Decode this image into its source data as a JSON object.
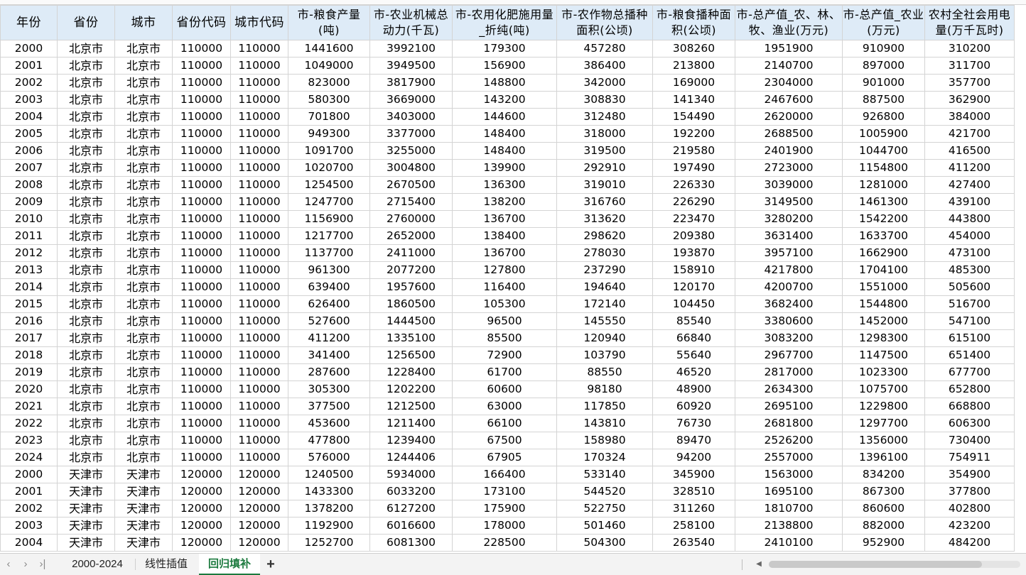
{
  "headers": [
    "年份",
    "省份",
    "城市",
    "省份代码",
    "城市代码",
    "市-粮食产量(吨)",
    "市-农业机械总动力(千瓦)",
    "市-农用化肥施用量_折纯(吨)",
    "市-农作物总播种面积(公顷)",
    "市-粮食播种面积(公顷)",
    "市-总产值_农、林、牧、渔业(万元)",
    "市-总产值_农业(万元)",
    "农村全社会用电量(万千瓦时)"
  ],
  "rows": [
    [
      "2000",
      "北京市",
      "北京市",
      "110000",
      "110000",
      "1441600",
      "3992100",
      "179300",
      "457280",
      "308260",
      "1951900",
      "910900",
      "310200"
    ],
    [
      "2001",
      "北京市",
      "北京市",
      "110000",
      "110000",
      "1049000",
      "3949500",
      "156900",
      "386400",
      "213800",
      "2140700",
      "897000",
      "311700"
    ],
    [
      "2002",
      "北京市",
      "北京市",
      "110000",
      "110000",
      "823000",
      "3817900",
      "148800",
      "342000",
      "169000",
      "2304000",
      "901000",
      "357700"
    ],
    [
      "2003",
      "北京市",
      "北京市",
      "110000",
      "110000",
      "580300",
      "3669000",
      "143200",
      "308830",
      "141340",
      "2467600",
      "887500",
      "362900"
    ],
    [
      "2004",
      "北京市",
      "北京市",
      "110000",
      "110000",
      "701800",
      "3403000",
      "144600",
      "312480",
      "154490",
      "2620000",
      "926800",
      "384000"
    ],
    [
      "2005",
      "北京市",
      "北京市",
      "110000",
      "110000",
      "949300",
      "3377000",
      "148400",
      "318000",
      "192200",
      "2688500",
      "1005900",
      "421700"
    ],
    [
      "2006",
      "北京市",
      "北京市",
      "110000",
      "110000",
      "1091700",
      "3255000",
      "148400",
      "319500",
      "219580",
      "2401900",
      "1044700",
      "416500"
    ],
    [
      "2007",
      "北京市",
      "北京市",
      "110000",
      "110000",
      "1020700",
      "3004800",
      "139900",
      "292910",
      "197490",
      "2723000",
      "1154800",
      "411200"
    ],
    [
      "2008",
      "北京市",
      "北京市",
      "110000",
      "110000",
      "1254500",
      "2670500",
      "136300",
      "319010",
      "226330",
      "3039000",
      "1281000",
      "427400"
    ],
    [
      "2009",
      "北京市",
      "北京市",
      "110000",
      "110000",
      "1247700",
      "2715400",
      "138200",
      "316760",
      "226290",
      "3149500",
      "1461300",
      "439100"
    ],
    [
      "2010",
      "北京市",
      "北京市",
      "110000",
      "110000",
      "1156900",
      "2760000",
      "136700",
      "313620",
      "223470",
      "3280200",
      "1542200",
      "443800"
    ],
    [
      "2011",
      "北京市",
      "北京市",
      "110000",
      "110000",
      "1217700",
      "2652000",
      "138400",
      "298620",
      "209380",
      "3631400",
      "1633700",
      "454000"
    ],
    [
      "2012",
      "北京市",
      "北京市",
      "110000",
      "110000",
      "1137700",
      "2411000",
      "136700",
      "278030",
      "193870",
      "3957100",
      "1662900",
      "473100"
    ],
    [
      "2013",
      "北京市",
      "北京市",
      "110000",
      "110000",
      "961300",
      "2077200",
      "127800",
      "237290",
      "158910",
      "4217800",
      "1704100",
      "485300"
    ],
    [
      "2014",
      "北京市",
      "北京市",
      "110000",
      "110000",
      "639400",
      "1957600",
      "116400",
      "194640",
      "120170",
      "4200700",
      "1551000",
      "505600"
    ],
    [
      "2015",
      "北京市",
      "北京市",
      "110000",
      "110000",
      "626400",
      "1860500",
      "105300",
      "172140",
      "104450",
      "3682400",
      "1544800",
      "516700"
    ],
    [
      "2016",
      "北京市",
      "北京市",
      "110000",
      "110000",
      "527600",
      "1444500",
      "96500",
      "145550",
      "85540",
      "3380600",
      "1452000",
      "547100"
    ],
    [
      "2017",
      "北京市",
      "北京市",
      "110000",
      "110000",
      "411200",
      "1335100",
      "85500",
      "120940",
      "66840",
      "3083200",
      "1298300",
      "615100"
    ],
    [
      "2018",
      "北京市",
      "北京市",
      "110000",
      "110000",
      "341400",
      "1256500",
      "72900",
      "103790",
      "55640",
      "2967700",
      "1147500",
      "651400"
    ],
    [
      "2019",
      "北京市",
      "北京市",
      "110000",
      "110000",
      "287600",
      "1228400",
      "61700",
      "88550",
      "46520",
      "2817000",
      "1023300",
      "677700"
    ],
    [
      "2020",
      "北京市",
      "北京市",
      "110000",
      "110000",
      "305300",
      "1202200",
      "60600",
      "98180",
      "48900",
      "2634300",
      "1075700",
      "652800"
    ],
    [
      "2021",
      "北京市",
      "北京市",
      "110000",
      "110000",
      "377500",
      "1212500",
      "63000",
      "117850",
      "60920",
      "2695100",
      "1229800",
      "668800"
    ],
    [
      "2022",
      "北京市",
      "北京市",
      "110000",
      "110000",
      "453600",
      "1211400",
      "66100",
      "143810",
      "76730",
      "2681800",
      "1297700",
      "606300"
    ],
    [
      "2023",
      "北京市",
      "北京市",
      "110000",
      "110000",
      "477800",
      "1239400",
      "67500",
      "158980",
      "89470",
      "2526200",
      "1356000",
      "730400"
    ],
    [
      "2024",
      "北京市",
      "北京市",
      "110000",
      "110000",
      "576000",
      "1244406",
      "67905",
      "170324",
      "94200",
      "2557000",
      "1396100",
      "754911"
    ],
    [
      "2000",
      "天津市",
      "天津市",
      "120000",
      "120000",
      "1240500",
      "5934000",
      "166400",
      "533140",
      "345900",
      "1563000",
      "834200",
      "354900"
    ],
    [
      "2001",
      "天津市",
      "天津市",
      "120000",
      "120000",
      "1433300",
      "6033200",
      "173100",
      "544520",
      "328510",
      "1695100",
      "867300",
      "377800"
    ],
    [
      "2002",
      "天津市",
      "天津市",
      "120000",
      "120000",
      "1378200",
      "6127200",
      "175900",
      "522750",
      "311260",
      "1810700",
      "860600",
      "402800"
    ],
    [
      "2003",
      "天津市",
      "天津市",
      "120000",
      "120000",
      "1192900",
      "6016600",
      "178000",
      "501460",
      "258100",
      "2138800",
      "882000",
      "423200"
    ],
    [
      "2004",
      "天津市",
      "天津市",
      "120000",
      "120000",
      "1252700",
      "6081300",
      "228500",
      "504300",
      "263540",
      "2410100",
      "952900",
      "484200"
    ]
  ],
  "tabs": [
    {
      "label": "2000-2024",
      "active": false
    },
    {
      "label": "线性插值",
      "active": false
    },
    {
      "label": "回归填补",
      "active": true
    }
  ],
  "tab_add_label": "+",
  "colors": {
    "header_bg": "#deebf7",
    "active_tab": "#1c7a3e",
    "grid": "#d4d4d4"
  }
}
